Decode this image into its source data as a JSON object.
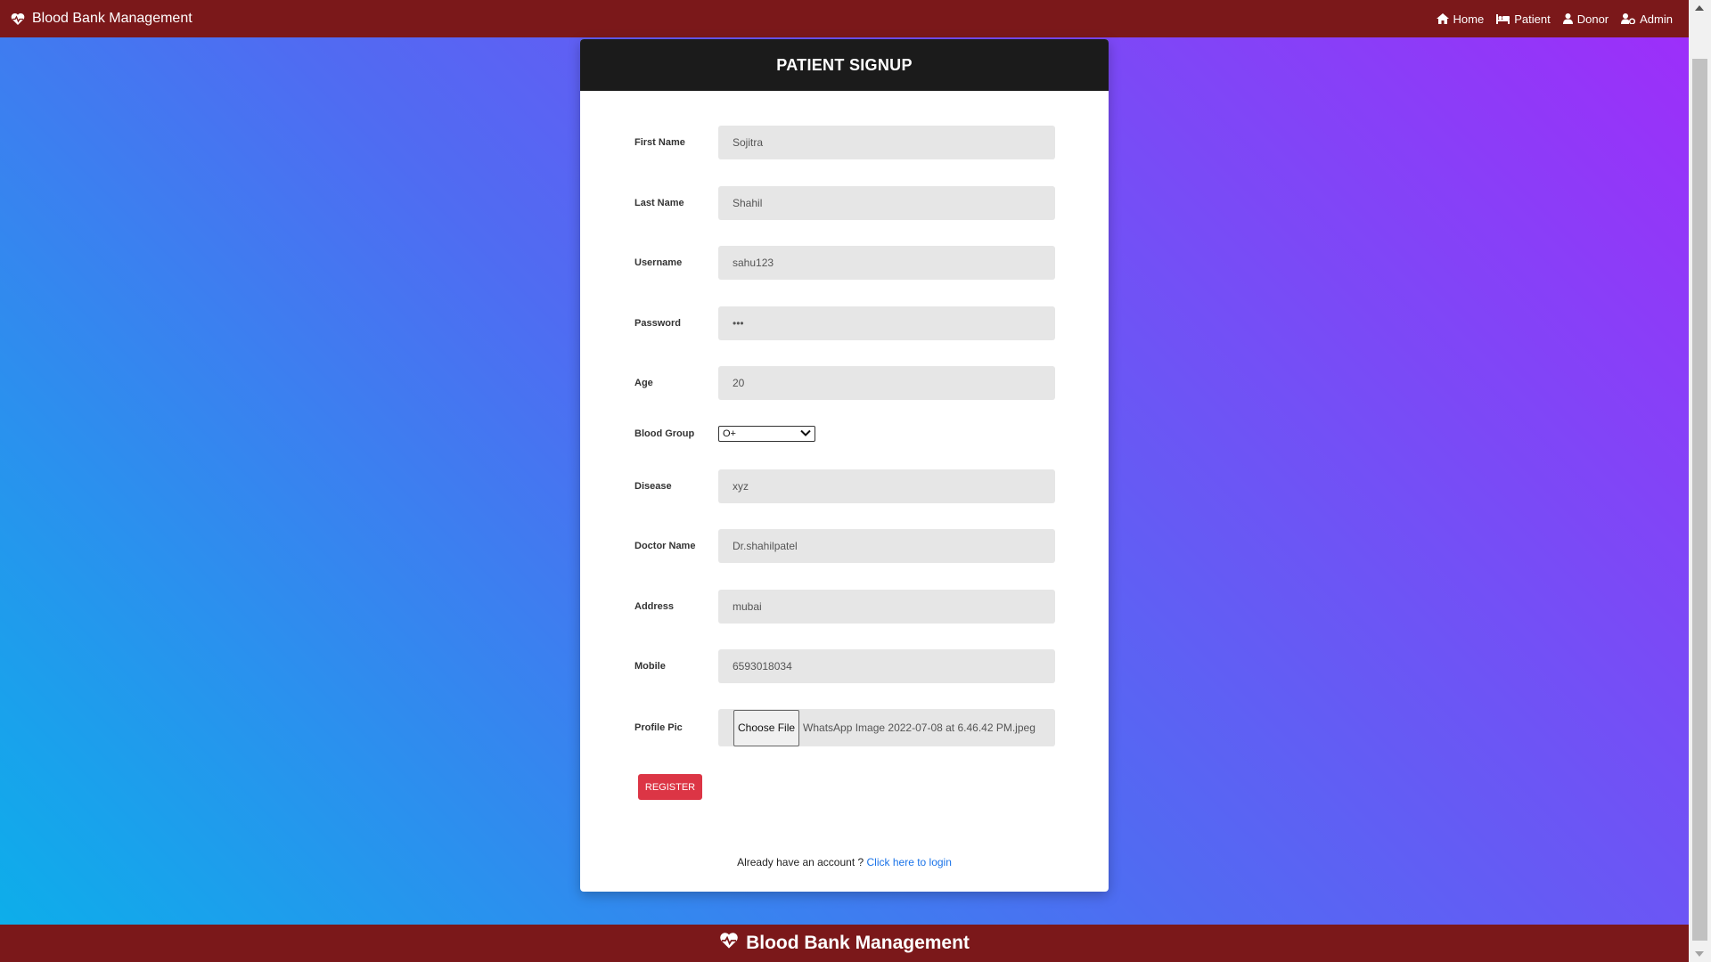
{
  "navbar": {
    "brand": "Blood Bank Management",
    "links": [
      {
        "label": "Home",
        "icon": "home-icon"
      },
      {
        "label": "Patient",
        "icon": "bed-icon"
      },
      {
        "label": "Donor",
        "icon": "user-icon"
      },
      {
        "label": "Admin",
        "icon": "user-cog-icon"
      }
    ]
  },
  "form": {
    "title": "PATIENT SIGNUP",
    "first_name": {
      "label": "First Name",
      "value": "Sojitra"
    },
    "last_name": {
      "label": "Last Name",
      "value": "Shahil"
    },
    "username": {
      "label": "Username",
      "value": "sahu123"
    },
    "password": {
      "label": "Password",
      "value": "•••"
    },
    "age": {
      "label": "Age",
      "value": "20"
    },
    "blood_group": {
      "label": "Blood Group",
      "value": "O+"
    },
    "disease": {
      "label": "Disease",
      "value": "xyz"
    },
    "doctor_name": {
      "label": "Doctor Name",
      "value": "Dr.shahilpatel"
    },
    "address": {
      "label": "Address",
      "value": "mubai"
    },
    "mobile": {
      "label": "Mobile",
      "value": "6593018034"
    },
    "profile_pic": {
      "label": "Profile Pic",
      "button": "Choose File",
      "filename": "WhatsApp Image 2022-07-08 at 6.46.42 PM.jpeg"
    },
    "register_label": "REGISTER",
    "login_prompt": "Already have an account ? ",
    "login_link": "Click here to login"
  },
  "footer": {
    "brand": "Blood Bank Management"
  },
  "colors": {
    "navbar": "#7b181a",
    "card_header": "#1b1b1b",
    "register": "#dc3545",
    "link": "#1a73e8"
  }
}
